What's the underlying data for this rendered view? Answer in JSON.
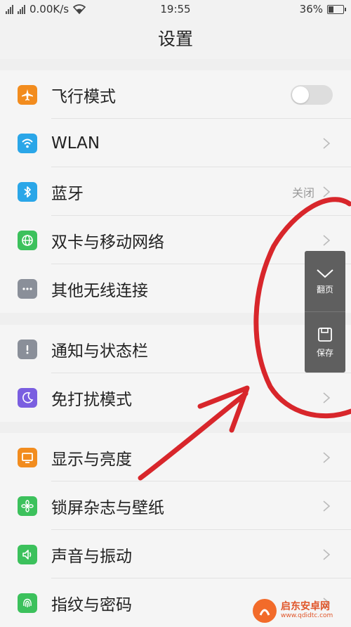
{
  "status_bar": {
    "network": "0.00K/s",
    "time": "19:55",
    "battery": "36%",
    "battery_level": 0.36
  },
  "header": {
    "title": "设置"
  },
  "sections": [
    {
      "items": [
        {
          "id": "airplane",
          "label": "飞行模式",
          "icon": "airplane-icon",
          "color": "#f28c1e",
          "control": "toggle",
          "on": false
        },
        {
          "id": "wlan",
          "label": "WLAN",
          "icon": "wifi-icon",
          "color": "#2aa6e8",
          "control": "chevron"
        },
        {
          "id": "bluetooth",
          "label": "蓝牙",
          "value": "关闭",
          "icon": "bluetooth-icon",
          "color": "#2aa6e8",
          "control": "chevron"
        },
        {
          "id": "dual-sim",
          "label": "双卡与移动网络",
          "icon": "globe-icon",
          "color": "#3cc15c",
          "control": "chevron"
        },
        {
          "id": "other-wireless",
          "label": "其他无线连接",
          "icon": "more-icon",
          "color": "#8a8f99",
          "control": "chevron"
        }
      ]
    },
    {
      "items": [
        {
          "id": "notifications",
          "label": "通知与状态栏",
          "icon": "exclamation-icon",
          "color": "#8a8f99",
          "control": "chevron"
        },
        {
          "id": "dnd",
          "label": "免打扰模式",
          "icon": "moon-icon",
          "color": "#7a5ee0",
          "control": "chevron"
        }
      ]
    },
    {
      "items": [
        {
          "id": "display",
          "label": "显示与亮度",
          "icon": "monitor-icon",
          "color": "#f28c1e",
          "control": "chevron"
        },
        {
          "id": "lockscreen",
          "label": "锁屏杂志与壁纸",
          "icon": "flower-icon",
          "color": "#3cc15c",
          "control": "chevron"
        },
        {
          "id": "sound",
          "label": "声音与振动",
          "icon": "speaker-icon",
          "color": "#3cc15c",
          "control": "chevron"
        },
        {
          "id": "fingerprint",
          "label": "指纹与密码",
          "icon": "fingerprint-icon",
          "color": "#3cc15c",
          "control": "chevron"
        }
      ]
    }
  ],
  "floating_panel": {
    "buttons": [
      {
        "id": "page-turn",
        "label": "翻页",
        "icon": "chevron-down-icon"
      },
      {
        "id": "save",
        "label": "保存",
        "icon": "save-icon"
      }
    ]
  },
  "watermark": {
    "name": "启东安卓网",
    "url": "www.qdidtc.com"
  }
}
